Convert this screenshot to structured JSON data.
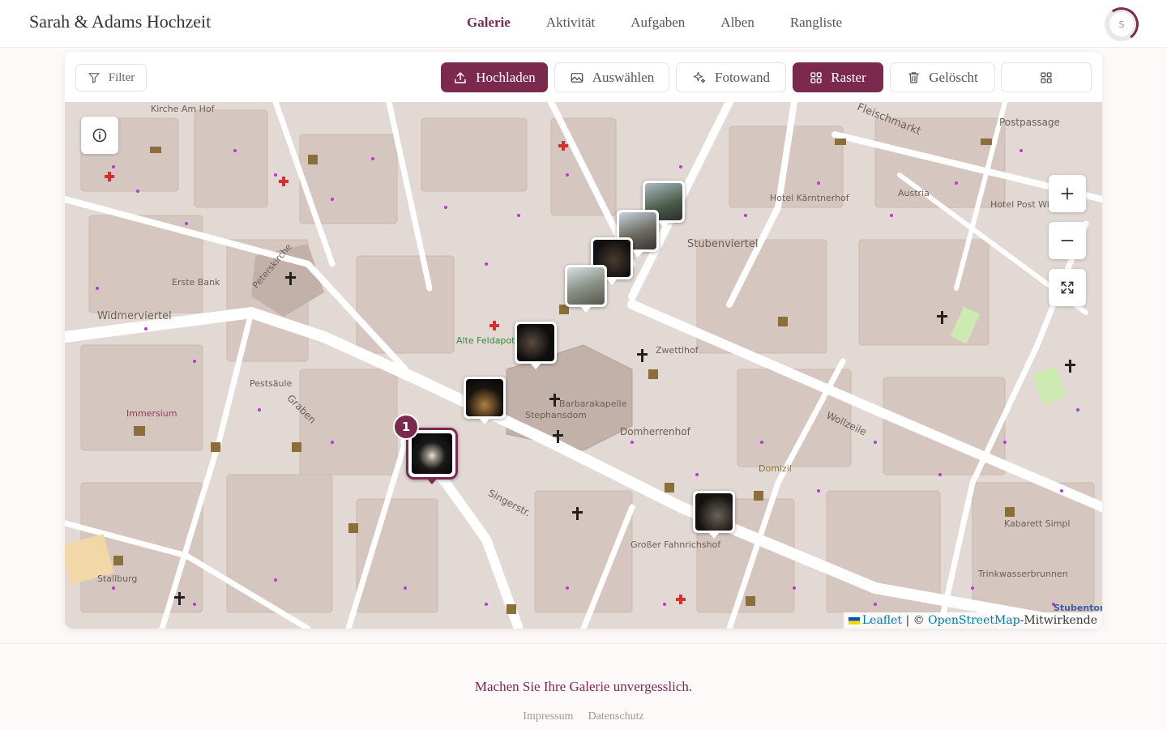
{
  "header": {
    "brand": "Sarah & Adams Hochzeit",
    "nav": [
      {
        "label": "Galerie",
        "active": true
      },
      {
        "label": "Aktivität",
        "active": false
      },
      {
        "label": "Aufgaben",
        "active": false
      },
      {
        "label": "Alben",
        "active": false
      },
      {
        "label": "Rangliste",
        "active": false
      }
    ],
    "avatar_initial": "S"
  },
  "toolbar": {
    "filter": "Filter",
    "upload": "Hochladen",
    "select": "Auswählen",
    "photowall": "Fotowand",
    "grid": "Raster",
    "deleted": "Gelöscht"
  },
  "map": {
    "cluster_count": "1",
    "labels": {
      "kirche_am_hof": "Kirche Am Hof",
      "postpassage": "Postpassage",
      "fleischmarkt": "Fleischmarkt",
      "hotel_kaerntnerhof": "Hotel Kärntnerhof",
      "stubenviertel": "Stubenviertel",
      "erste_bank": "Erste Bank",
      "widmerviertel": "Widmerviertel",
      "alte_feldapotheke": "Alte Feldapotheke",
      "barbarakapelle": "Barbarakapelle",
      "stephansdom": "Stephansdom",
      "zwettlhof": "Zwettlhof",
      "pestsaule": "Pestsäule",
      "immersium": "Immersium",
      "domherrenhof": "Domherrenhof",
      "domizil": "Domizil",
      "kabarett": "Kabarett Simpl",
      "trinkwasser": "Trinkwasserbrunnen",
      "stallburg": "Stallburg",
      "grosser_fahnrichshof": "Großer Fahnrichshof",
      "stubentor": "Stubentor",
      "austria": "Austria",
      "hotel_post": "Hotel Post Wien",
      "peterskirche": "Peterskirche",
      "graben": "Graben",
      "singerstr": "Singerstr.",
      "wollzeile": "Wollzeile"
    },
    "attribution": {
      "leaflet": "Leaflet",
      "separator": " | © ",
      "osm": "OpenStreetMap",
      "contributors": "-Mitwirkende"
    },
    "colors": {
      "accent": "#7b2a4d",
      "map_bg": "#e2d9d4",
      "building": "#d5c7c0",
      "road": "#ffffff"
    }
  },
  "footer": {
    "tagline": "Machen Sie Ihre Galerie unvergesslich.",
    "imprint": "Impressum",
    "privacy": "Datenschutz"
  }
}
